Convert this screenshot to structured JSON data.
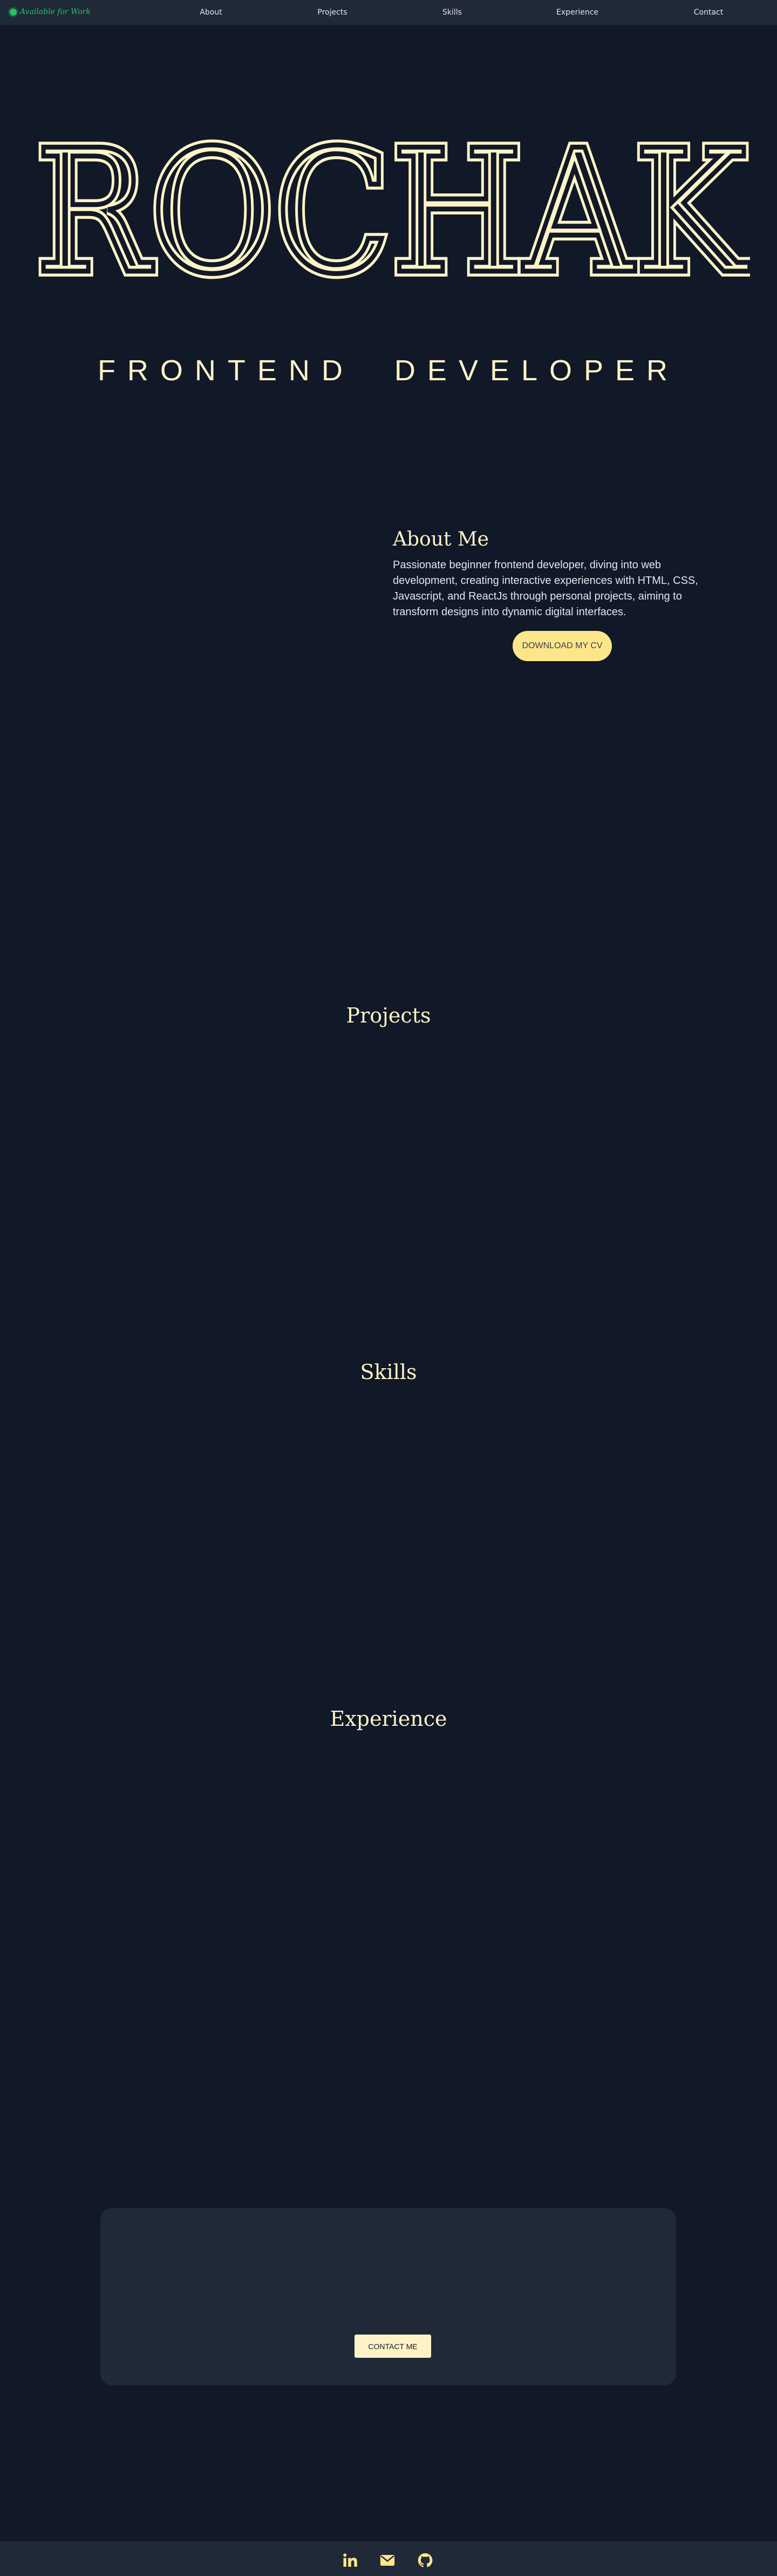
{
  "nav": {
    "status_label": "Available for Work",
    "links": [
      "About",
      "Projects",
      "Skills",
      "Experience",
      "Contact"
    ]
  },
  "hero": {
    "name": "ROCHAK",
    "subtitle": "FRONTEND  DEVELOPER"
  },
  "about": {
    "title": "About Me",
    "text": "Passionate beginner frontend developer, diving into web development, creating interactive experiences with HTML, CSS, Javascript, and ReactJs through personal projects, aiming to transform designs into dynamic digital interfaces.",
    "button_label": "DOWNLOAD MY CV"
  },
  "sections": {
    "projects_title": "Projects",
    "skills_title": "Skills",
    "experience_title": "Experience"
  },
  "contact": {
    "button_label": "CONTACT ME"
  },
  "footer": {
    "icons": [
      "linkedin-icon",
      "email-icon",
      "github-icon"
    ]
  },
  "colors": {
    "background": "#111827",
    "surface": "#1f2937",
    "accent": "#fef3c7",
    "status": "#22c55e"
  }
}
